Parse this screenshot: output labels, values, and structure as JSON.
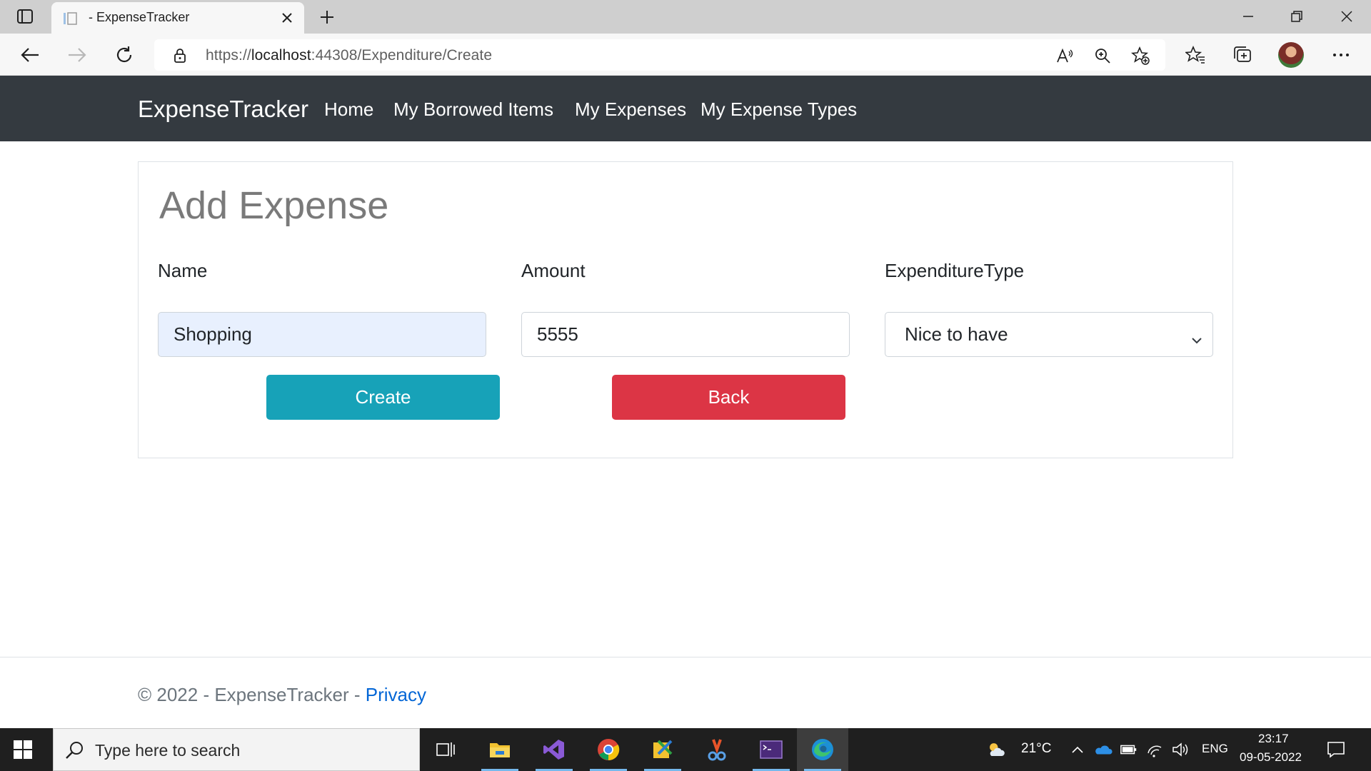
{
  "browser": {
    "tab_title": "- ExpenseTracker",
    "url_scheme": "https://",
    "url_host": "localhost",
    "url_rest": ":44308/Expenditure/Create"
  },
  "site": {
    "brand": "ExpenseTracker",
    "nav": [
      "Home",
      "My Borrowed Items",
      "My Expenses",
      "My Expense Types"
    ]
  },
  "form": {
    "title": "Add Expense",
    "name_label": "Name",
    "name_value": "Shopping",
    "amount_label": "Amount",
    "amount_value": "5555",
    "type_label": "ExpenditureType",
    "type_selected": "Nice to have",
    "create_label": "Create",
    "back_label": "Back"
  },
  "footer": {
    "text": "© 2022 - ExpenseTracker - ",
    "privacy_link": "Privacy"
  },
  "taskbar": {
    "search_placeholder": "Type here to search",
    "weather": "21°C",
    "language": "ENG",
    "time": "23:17",
    "date": "09-05-2022"
  },
  "colors": {
    "navbar": "#343a40",
    "create_button": "#17a2b8",
    "back_button": "#dc3545",
    "autofill": "#e8f0fe",
    "link": "#0366d6"
  }
}
